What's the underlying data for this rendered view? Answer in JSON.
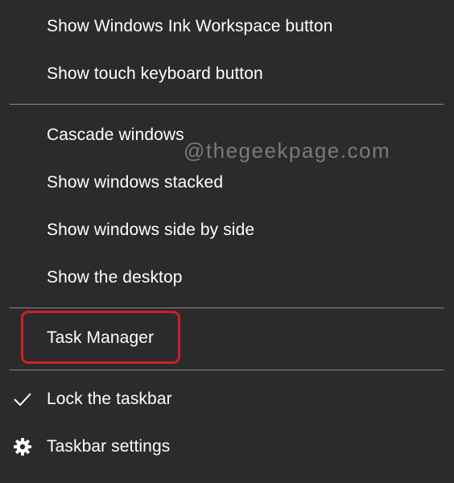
{
  "context_menu": {
    "items": [
      {
        "label": "Show Windows Ink Workspace button"
      },
      {
        "label": "Show touch keyboard button"
      },
      {
        "label": "Cascade windows"
      },
      {
        "label": "Show windows stacked"
      },
      {
        "label": "Show windows side by side"
      },
      {
        "label": "Show the desktop"
      },
      {
        "label": "Task Manager",
        "highlighted": true,
        "highlight_color": "#d01f2a"
      },
      {
        "label": "Lock the taskbar",
        "checked": true,
        "icon": "checkmark-icon"
      },
      {
        "label": "Taskbar settings",
        "icon": "gear-icon"
      }
    ]
  },
  "watermark": "@thegeekpage.com",
  "colors": {
    "background": "#2b2b2b",
    "text": "#ffffff",
    "separator": "#8a8a8a",
    "highlight_border": "#d01f2a"
  }
}
